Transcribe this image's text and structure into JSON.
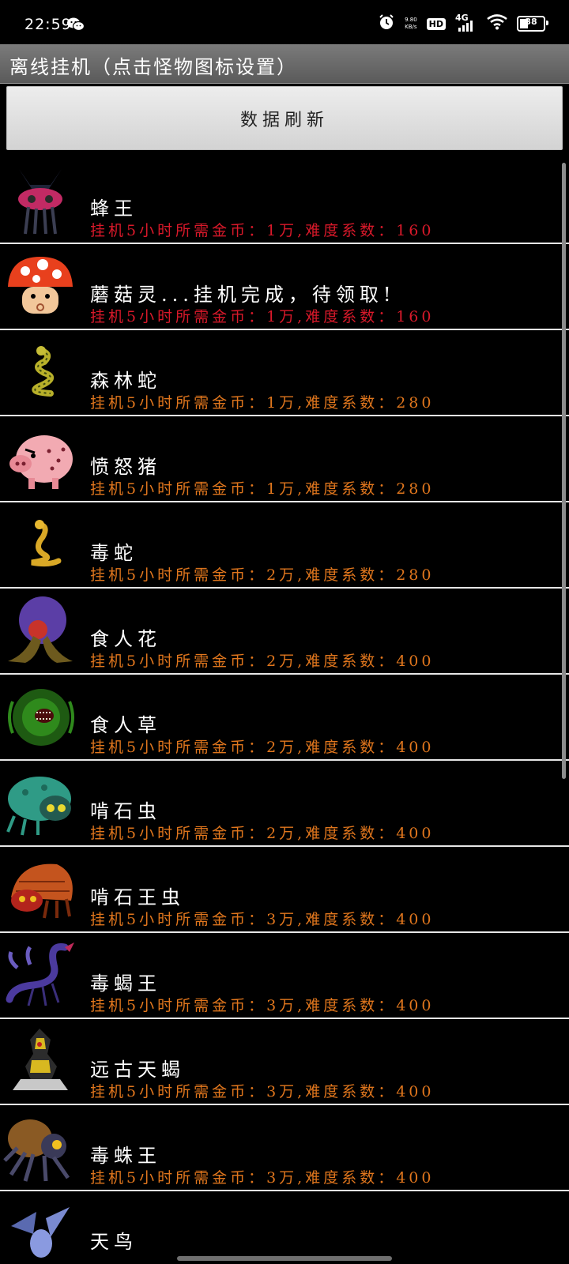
{
  "status_bar": {
    "time": "22:59",
    "net_speed_value": "9.80",
    "net_speed_unit": "KB/s",
    "hd_label": "HD",
    "network_label": "4G",
    "battery": "38"
  },
  "title": "离线挂机（点击怪物图标设置）",
  "refresh_button": "数据刷新",
  "colors": {
    "red": "#d9192a",
    "orange": "#e0761d",
    "title_bar": "#6a6a6a"
  },
  "monsters": [
    {
      "name": "蜂王",
      "info": "挂机5小时所需金币：1万,难度系数：160",
      "info_color": "red",
      "icon": "bee-queen-icon"
    },
    {
      "name": "蘑菇灵...挂机完成，待领取!",
      "info": "挂机5小时所需金币：1万,难度系数：160",
      "info_color": "red",
      "icon": "mushroom-spirit-icon"
    },
    {
      "name": "森林蛇",
      "info": "挂机5小时所需金币：1万,难度系数：280",
      "info_color": "orange",
      "icon": "forest-snake-icon"
    },
    {
      "name": "愤怒猪",
      "info": "挂机5小时所需金币：1万,难度系数：280",
      "info_color": "orange",
      "icon": "angry-pig-icon"
    },
    {
      "name": "毒蛇",
      "info": "挂机5小时所需金币：2万,难度系数：280",
      "info_color": "orange",
      "icon": "viper-icon"
    },
    {
      "name": "食人花",
      "info": "挂机5小时所需金币：2万,难度系数：400",
      "info_color": "orange",
      "icon": "maneater-flower-icon"
    },
    {
      "name": "食人草",
      "info": "挂机5小时所需金币：2万,难度系数：400",
      "info_color": "orange",
      "icon": "maneater-grass-icon"
    },
    {
      "name": "啃石虫",
      "info": "挂机5小时所需金币：2万,难度系数：400",
      "info_color": "orange",
      "icon": "stone-bug-icon"
    },
    {
      "name": "啃石王虫",
      "info": "挂机5小时所需金币：3万,难度系数：400",
      "info_color": "orange",
      "icon": "stone-bug-king-icon"
    },
    {
      "name": "毒蝎王",
      "info": "挂机5小时所需金币：3万,难度系数：400",
      "info_color": "orange",
      "icon": "scorpion-king-icon"
    },
    {
      "name": "远古天蝎",
      "info": "挂机5小时所需金币：3万,难度系数：400",
      "info_color": "orange",
      "icon": "ancient-scorpion-icon"
    },
    {
      "name": "毒蛛王",
      "info": "挂机5小时所需金币：3万,难度系数：400",
      "info_color": "orange",
      "icon": "spider-king-icon"
    },
    {
      "name": "天鸟",
      "info": "",
      "info_color": "orange",
      "icon": "sky-bird-icon"
    }
  ]
}
